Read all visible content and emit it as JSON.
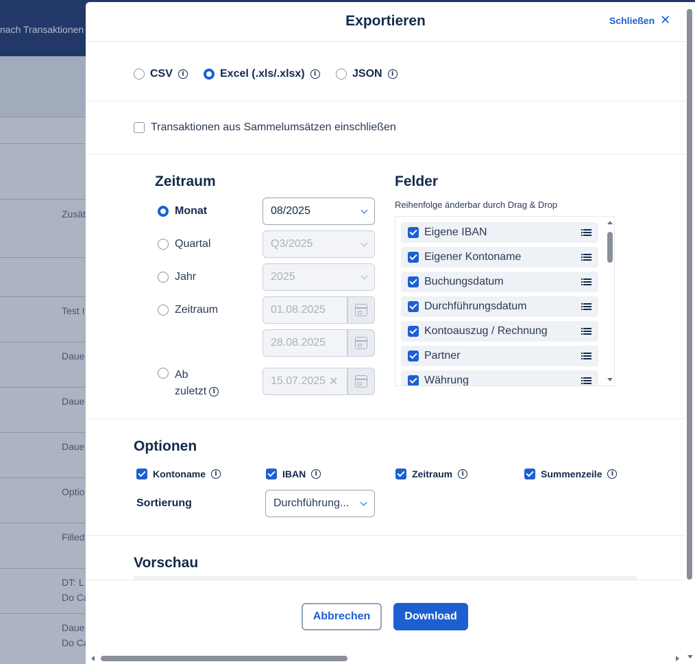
{
  "background": {
    "topbar_text": "nach Transaktionen",
    "rows": [
      "Zusät",
      "Test I",
      "Daue",
      "Daue",
      "Daue",
      "Optio",
      "Filled",
      "DT: L",
      "Do Ca",
      "Daue",
      "Do Ca"
    ]
  },
  "modal": {
    "title": "Exportieren",
    "close_label": "Schließen",
    "formats": [
      {
        "label": "CSV",
        "selected": false
      },
      {
        "label": "Excel (.xls/.xlsx)",
        "selected": true
      },
      {
        "label": "JSON",
        "selected": false
      }
    ],
    "sammel_label": "Transaktionen aus Sammelumsätzen einschließen",
    "zeitraum": {
      "heading": "Zeitraum",
      "options": {
        "monat": "Monat",
        "quartal": "Quartal",
        "jahr": "Jahr",
        "zeitraum": "Zeitraum",
        "ab": "Ab",
        "zuletzt": "zuletzt"
      },
      "monat_value": "08/2025",
      "quartal_value": "Q3/2025",
      "jahr_value": "2025",
      "from_value": "01.08.2025",
      "to_value": "28.08.2025",
      "ab_value": "15.07.2025"
    },
    "felder": {
      "heading": "Felder",
      "subtitle": "Reihenfolge änderbar durch Drag & Drop",
      "items": [
        "Eigene IBAN",
        "Eigener Kontoname",
        "Buchungsdatum",
        "Durchführungsdatum",
        "Kontoauszug / Rechnung",
        "Partner",
        "Währung"
      ]
    },
    "optionen": {
      "heading": "Optionen",
      "checks": [
        "Kontoname",
        "IBAN",
        "Zeitraum",
        "Summenzeile"
      ],
      "sort_label": "Sortierung",
      "sort_value": "Durchführung..."
    },
    "vorschau_heading": "Vorschau",
    "buttons": {
      "cancel": "Abbrechen",
      "download": "Download"
    }
  },
  "colors": {
    "accent": "#1c5fd0",
    "text": "#13294b",
    "topbar": "#0f2a63"
  }
}
